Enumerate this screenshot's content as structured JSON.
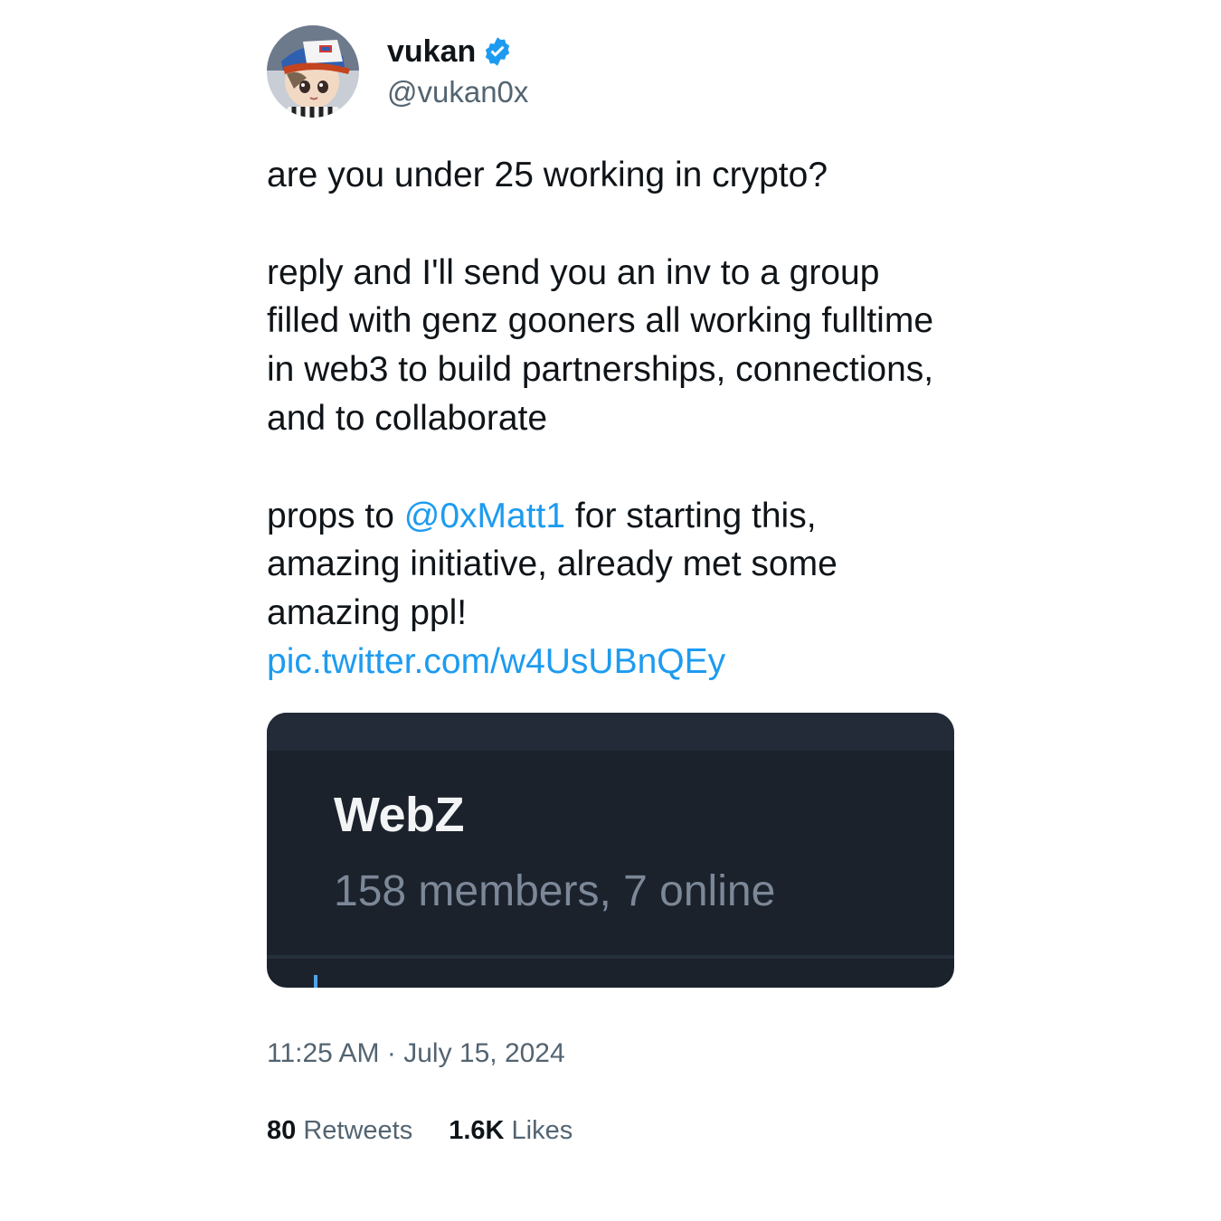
{
  "author": {
    "display_name": "vukan",
    "handle": "@vukan0x",
    "verified": true,
    "avatar_icon": "anime-avatar-icon",
    "verified_color": "#1d9bf0"
  },
  "tweet": {
    "line1": "are you under 25 working in crypto?",
    "para2": "reply and I'll send you an inv to a group filled with genz gooners all working fulltime in web3 to build partnerships, connections, and to collaborate",
    "para3_prefix": "props to ",
    "mention": "@0xMatt1",
    "para3_suffix": " for starting this, amazing initiative, already met some amazing ppl!",
    "pic_link": "pic.twitter.com/w4UsUBnQEy"
  },
  "media": {
    "group_name": "WebZ",
    "group_meta": "158 members, 7 online"
  },
  "meta": {
    "time": "11:25 AM",
    "separator": "·",
    "date": "July 15, 2024"
  },
  "stats": {
    "retweets_count": "80",
    "retweets_label": "Retweets",
    "likes_count": "1.6K",
    "likes_label": "Likes"
  }
}
